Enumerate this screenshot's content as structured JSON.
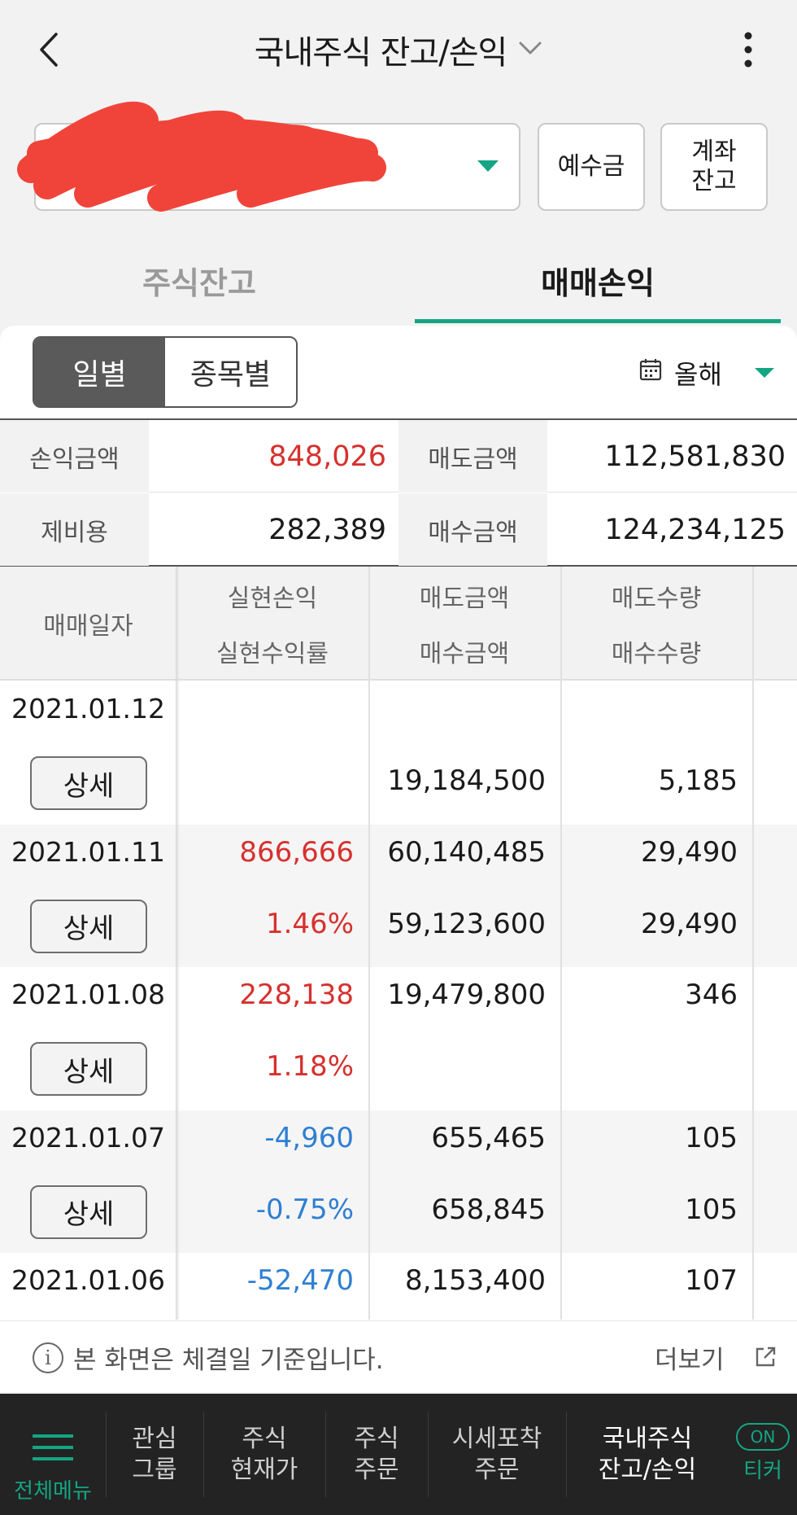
{
  "header": {
    "title": "국내주식 잔고/손익"
  },
  "account": {
    "deposit_label": "예수금",
    "balance_label": "계좌\n잔고"
  },
  "tabs": [
    {
      "label": "주식잔고",
      "active": false
    },
    {
      "label": "매매손익",
      "active": true
    }
  ],
  "segment": {
    "daily": "일별",
    "by_stock": "종목별"
  },
  "period": {
    "label": "올해"
  },
  "summary": {
    "profit_label": "손익금액",
    "profit_value": "848,026",
    "sell_label": "매도금액",
    "sell_value": "112,581,830",
    "fee_label": "제비용",
    "fee_value": "282,389",
    "buy_label": "매수금액",
    "buy_value": "124,234,125"
  },
  "table": {
    "headers": {
      "date": "매매일자",
      "realized_pl": "실현손익",
      "realized_rate": "실현수익률",
      "sell_amount": "매도금액",
      "buy_amount": "매수금액",
      "sell_qty": "매도수량",
      "buy_qty": "매수수량"
    },
    "detail_label": "상세",
    "rows": [
      {
        "date": "2021.01.12",
        "pl": "",
        "rate": "",
        "sell_amt": "",
        "buy_amt": "19,184,500",
        "sell_qty": "",
        "buy_qty": "5,185"
      },
      {
        "date": "2021.01.11",
        "pl": "866,666",
        "rate": "1.46%",
        "sell_amt": "60,140,485",
        "buy_amt": "59,123,600",
        "sell_qty": "29,490",
        "buy_qty": "29,490"
      },
      {
        "date": "2021.01.08",
        "pl": "228,138",
        "rate": "1.18%",
        "sell_amt": "19,479,800",
        "buy_amt": "",
        "sell_qty": "346",
        "buy_qty": ""
      },
      {
        "date": "2021.01.07",
        "pl": "-4,960",
        "rate": "-0.75%",
        "sell_amt": "655,465",
        "buy_amt": "658,845",
        "sell_qty": "105",
        "buy_qty": "105"
      },
      {
        "date": "2021.01.06",
        "pl": "-52,470",
        "rate": "",
        "sell_amt": "8,153,400",
        "buy_amt": "",
        "sell_qty": "107",
        "buy_qty": ""
      }
    ]
  },
  "footer": {
    "note": "본 화면은 체결일 기준입니다.",
    "more": "더보기"
  },
  "nav": {
    "menu": "전체메뉴",
    "items": [
      "관심\n그룹",
      "주식\n현재가",
      "주식\n주문",
      "시세포착\n주문",
      "국내주식\n잔고/손익"
    ],
    "ticker_pill": "ON",
    "ticker": "티커"
  },
  "colors": {
    "accent": "#14a583",
    "profit": "#d6312e",
    "loss": "#2f7fd2"
  }
}
